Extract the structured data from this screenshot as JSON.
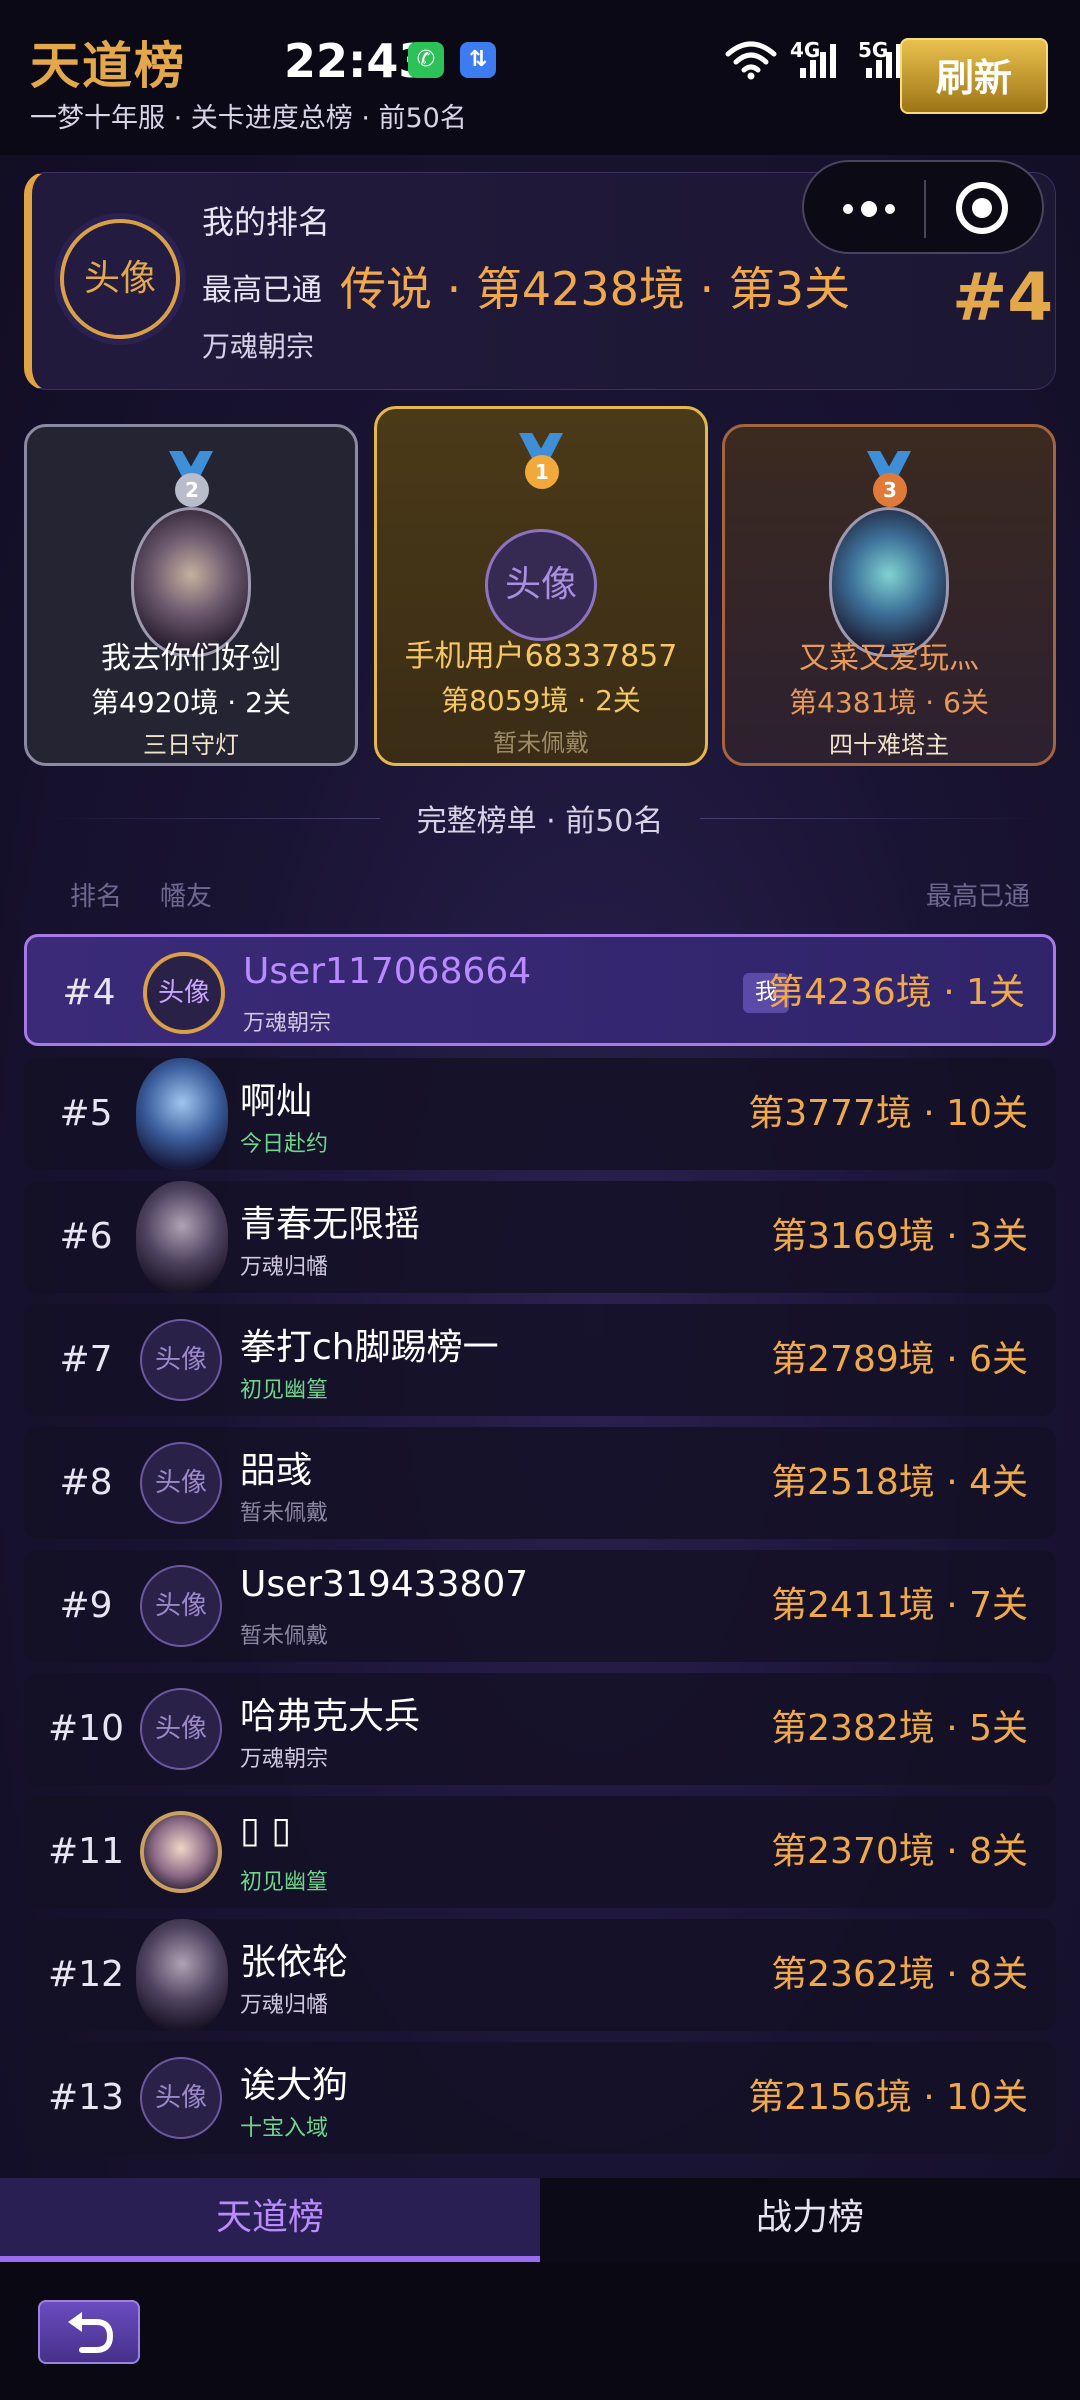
{
  "header": {
    "title": "天道榜",
    "subtitle": "一梦十年服 · 关卡进度总榜 · 前50名",
    "time": "22:43",
    "net_4g": "4G",
    "net_5g": "5G",
    "refresh_label": "刷新"
  },
  "my_rank": {
    "section_label": "我的排名",
    "avatar_text": "头像",
    "best_prefix": "最高已通",
    "best_stage": "传说 · 第4238境 · 第3关",
    "guild": "万魂朝宗",
    "rank_label": "排名",
    "rank_value": "#4"
  },
  "podium": [
    {
      "place": "2",
      "name": "我去你们好剑",
      "stage": "第4920境 · 2关",
      "title": "三日守灯",
      "medal_color": "#b9bccb"
    },
    {
      "place": "1",
      "name": "手机用户68337857",
      "stage": "第8059境 · 2关",
      "title": "暂未佩戴",
      "avatar_text": "头像",
      "medal_color": "#f0a93a"
    },
    {
      "place": "3",
      "name": "又菜又爱玩灬",
      "stage": "第4381境 · 6关",
      "title": "四十难塔主",
      "medal_color": "#e07a3a"
    }
  ],
  "list": {
    "heading": "完整榜单 · 前50名",
    "col_rank": "排名",
    "col_player": "幡友",
    "col_best": "最高已通",
    "me_badge": "我",
    "rows": [
      {
        "rank": "#4",
        "name": "User117068664",
        "sub": "万魂朝宗",
        "stage": "第4236境 · 1关",
        "avatar": "头像"
      },
      {
        "rank": "#5",
        "name": "啊灿",
        "sub": "今日赴约",
        "stage": "第3777境 · 10关",
        "avatar": ""
      },
      {
        "rank": "#6",
        "name": "青春无限摇",
        "sub": "万魂归幡",
        "stage": "第3169境 · 3关",
        "avatar": ""
      },
      {
        "rank": "#7",
        "name": "拳打ch脚踢榜一",
        "sub": "初见幽篁",
        "stage": "第2789境 · 6关",
        "avatar": "头像"
      },
      {
        "rank": "#8",
        "name": "㗊彧",
        "sub": "暂未佩戴",
        "stage": "第2518境 · 4关",
        "avatar": "头像"
      },
      {
        "rank": "#9",
        "name": "User319433807",
        "sub": "暂未佩戴",
        "stage": "第2411境 · 7关",
        "avatar": "头像"
      },
      {
        "rank": "#10",
        "name": "哈弗克大兵",
        "sub": "万魂朝宗",
        "stage": "第2382境 · 5关",
        "avatar": "头像"
      },
      {
        "rank": "#11",
        "name": "▯ ▯",
        "sub": "初见幽篁",
        "stage": "第2370境 · 8关",
        "avatar": ""
      },
      {
        "rank": "#12",
        "name": "张依轮",
        "sub": "万魂归幡",
        "stage": "第2362境 · 8关",
        "avatar": ""
      },
      {
        "rank": "#13",
        "name": "诶大狗",
        "sub": "十宝入域",
        "stage": "第2156境 · 10关",
        "avatar": "头像"
      }
    ]
  },
  "tabs": {
    "tab1": "天道榜",
    "tab2": "战力榜"
  },
  "icons": {
    "wechat": "wechat-icon",
    "message": "message-icon",
    "wifi": "wifi-icon",
    "menu": "more-dots-icon",
    "close": "target-icon",
    "back": "back-arrow-icon"
  },
  "colors": {
    "accent_gold": "#e3a84c",
    "accent_purple": "#b98bff",
    "stage_orange": "#f0a94a",
    "green_title": "#6fd68e"
  }
}
